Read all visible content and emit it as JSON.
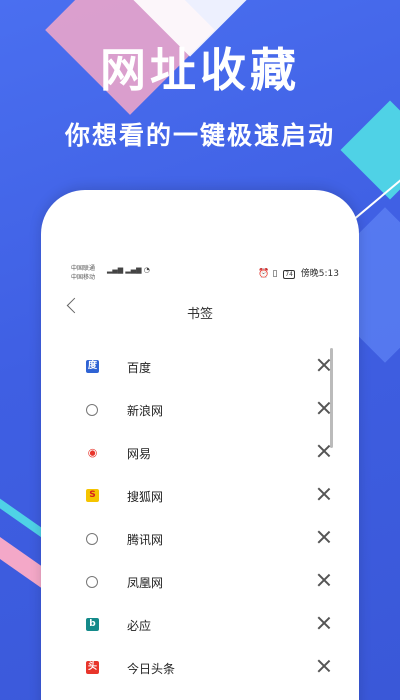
{
  "hero": {
    "title": "网址收藏",
    "subtitle": "你想看的一键极速启动"
  },
  "status_bar": {
    "carrier_1": "中国联通",
    "carrier_2": "中国移动",
    "signal_text": "⁴ᴳ",
    "battery": "74",
    "time": "傍晚5:13"
  },
  "nav": {
    "title": "书签"
  },
  "bookmarks": [
    {
      "label": "百度",
      "icon": "baidu-icon",
      "color": "#2f63d4"
    },
    {
      "label": "新浪网",
      "icon": "globe-icon",
      "color": "#777777"
    },
    {
      "label": "网易",
      "icon": "weibo-icon",
      "color": "#e8352b"
    },
    {
      "label": "搜狐网",
      "icon": "sohu-icon",
      "color": "#f5c400"
    },
    {
      "label": "腾讯网",
      "icon": "globe-icon",
      "color": "#777777"
    },
    {
      "label": "凤凰网",
      "icon": "globe-icon",
      "color": "#777777"
    },
    {
      "label": "必应",
      "icon": "bing-icon",
      "color": "#148a8a"
    },
    {
      "label": "今日头条",
      "icon": "toutiao-icon",
      "color": "#e8352b"
    }
  ],
  "colors": {
    "background": "#4a6ff0",
    "accent_pink": "#f4a8c8",
    "accent_cyan": "#4fd2e6"
  }
}
